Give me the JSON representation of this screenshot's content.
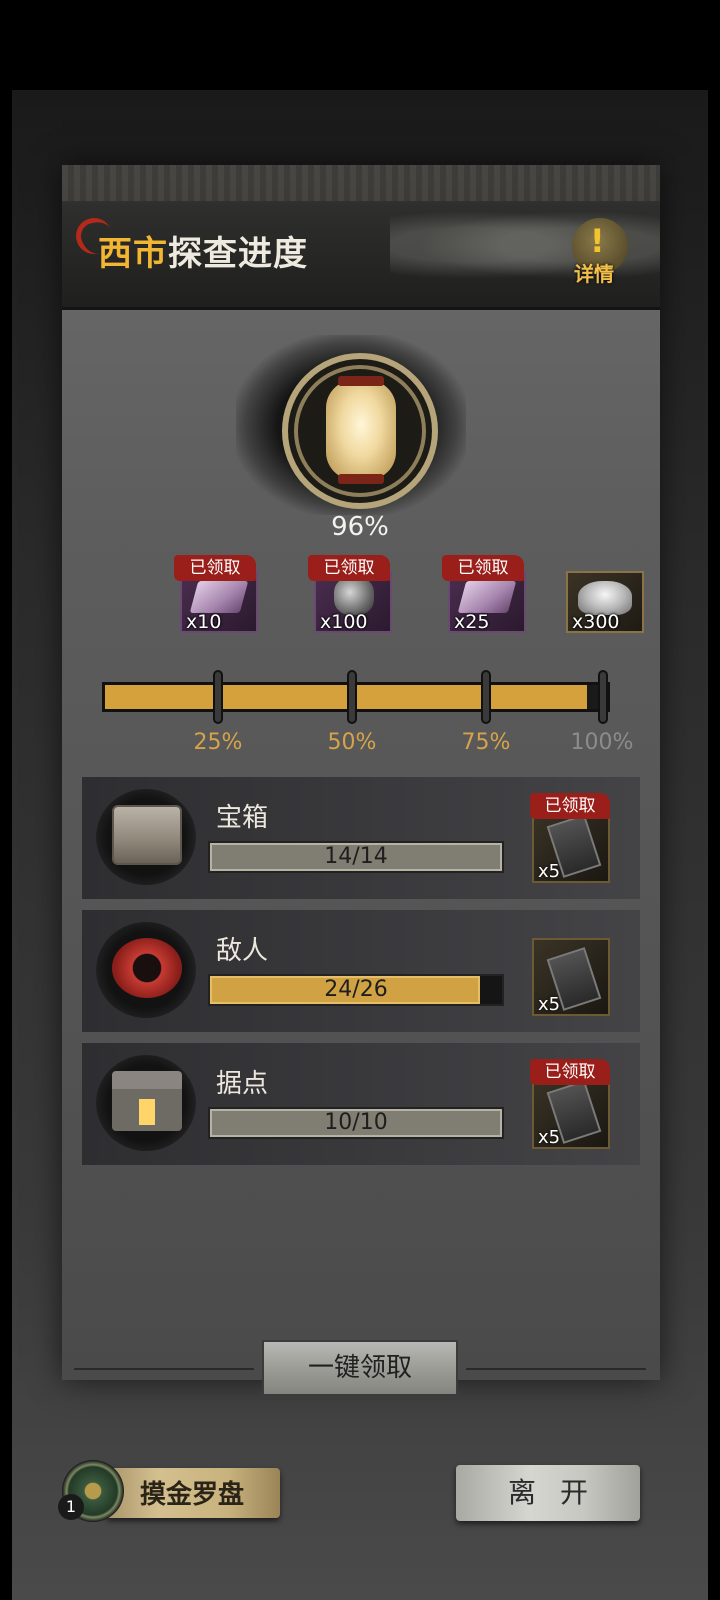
{
  "header": {
    "title_highlight": "西市",
    "title_rest": "探查进度",
    "details_icon": "!",
    "details_label": "详情"
  },
  "overall": {
    "progress_text": "96%",
    "progress_value": 96
  },
  "milestones": [
    {
      "label": "25%",
      "claimed_text": "已领取",
      "qty": "x10",
      "item": "purple-ingot-icon",
      "reached": true
    },
    {
      "label": "50%",
      "claimed_text": "已领取",
      "qty": "x100",
      "item": "ore-icon",
      "reached": true
    },
    {
      "label": "75%",
      "claimed_text": "已领取",
      "qty": "x25",
      "item": "purple-ingot-icon",
      "reached": true
    },
    {
      "label": "100%",
      "claimed_text": "",
      "qty": "x300",
      "item": "silver-ingot-icon",
      "reached": false
    }
  ],
  "tasks": [
    {
      "name": "宝箱",
      "progress_text": "14/14",
      "ratio": 1.0,
      "reward_qty": "x5",
      "claimed_text": "已领取",
      "icon": "chest-icon"
    },
    {
      "name": "敌人",
      "progress_text": "24/26",
      "ratio": 0.9231,
      "reward_qty": "x5",
      "claimed_text": "",
      "icon": "enemy-icon"
    },
    {
      "name": "据点",
      "progress_text": "10/10",
      "ratio": 1.0,
      "reward_qty": "x5",
      "claimed_text": "已领取",
      "icon": "stronghold-icon"
    }
  ],
  "actions": {
    "claim_all": "一键领取",
    "compass_label": "摸金罗盘",
    "compass_count": "1",
    "leave": "离开"
  },
  "colors": {
    "accent_gold": "#d4a13c",
    "title_highlight": "#f2b632",
    "claimed_badge": "#9a1e1a"
  }
}
